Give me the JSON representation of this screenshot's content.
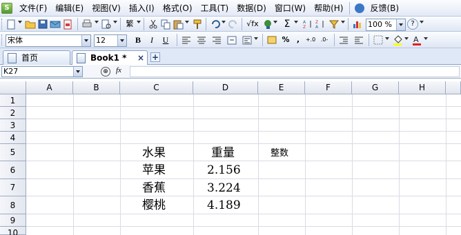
{
  "menu": {
    "items": [
      "文件(F)",
      "编辑(E)",
      "视图(V)",
      "插入(I)",
      "格式(O)",
      "工具(T)",
      "数据(D)",
      "窗口(W)",
      "帮助(H)"
    ],
    "feedback": "反馈(B)"
  },
  "toolbar": {
    "zoom": "100 %",
    "help": "?"
  },
  "format": {
    "font": "宋体",
    "size": "12",
    "bold": "B",
    "italic": "I",
    "underline": "U",
    "percent": "%",
    "comma": ","
  },
  "tabs": [
    {
      "label": "首页"
    },
    {
      "label": "Book1 *"
    }
  ],
  "tab_close": "×",
  "tab_add": "+",
  "formula": {
    "name": "K27",
    "fx": "fx",
    "value": ""
  },
  "columns": [
    "A",
    "B",
    "C",
    "D",
    "E",
    "F",
    "G",
    "H"
  ],
  "rows": [
    "1",
    "2",
    "3",
    "4",
    "5",
    "6",
    "7",
    "8",
    "9",
    "10"
  ],
  "cells": {
    "C5": "水果",
    "D5": "重量",
    "E5": "整数",
    "C6": "苹果",
    "D6": "2.156",
    "C7": "香蕉",
    "D7": "3.224",
    "C8": "樱桃",
    "D8": "4.189"
  },
  "colors": {
    "menubar": "#e3e9f5",
    "grid_line": "#d7dbe3",
    "header": "#e1e5ee"
  }
}
